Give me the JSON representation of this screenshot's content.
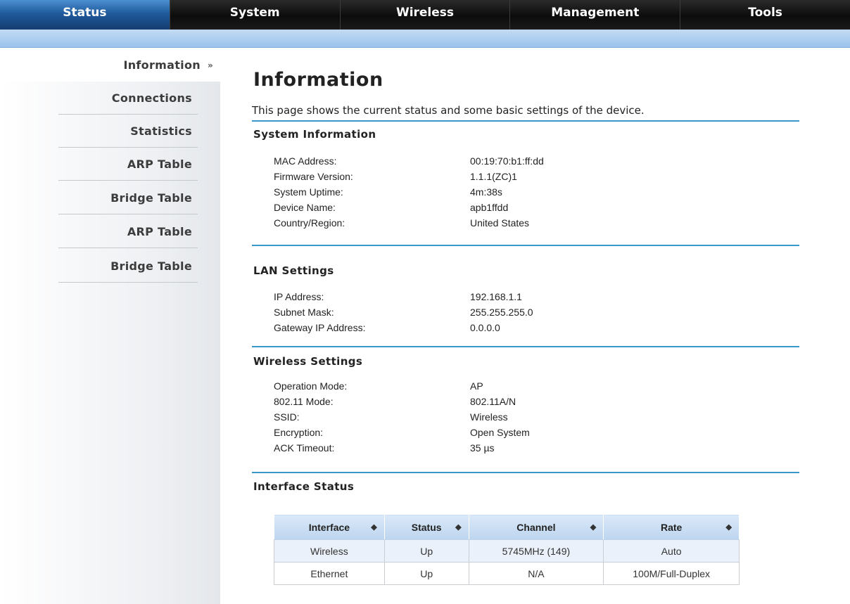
{
  "topnav": {
    "tabs": [
      {
        "label": "Status",
        "active": true
      },
      {
        "label": "System",
        "active": false
      },
      {
        "label": "Wireless",
        "active": false
      },
      {
        "label": "Management",
        "active": false
      },
      {
        "label": "Tools",
        "active": false
      }
    ]
  },
  "sidebar": {
    "items": [
      {
        "label": "Information",
        "active": true,
        "arrow": "»"
      },
      {
        "label": "Connections"
      },
      {
        "label": "Statistics"
      },
      {
        "label": "ARP Table"
      },
      {
        "label": "Bridge Table"
      },
      {
        "label": "ARP Table"
      },
      {
        "label": "Bridge Table"
      }
    ]
  },
  "page": {
    "title": "Information",
    "description": "This page shows the current status and some basic settings of the device."
  },
  "system_info": {
    "heading": "System Information",
    "rows": [
      {
        "label": "MAC Address:",
        "value": "00:19:70:b1:ff:dd"
      },
      {
        "label": "Firmware Version:",
        "value": "1.1.1(ZC)1"
      },
      {
        "label": "System Uptime:",
        "value": "4m:38s"
      },
      {
        "label": "Device Name:",
        "value": "apb1ffdd"
      },
      {
        "label": "Country/Region:",
        "value": "United States"
      }
    ]
  },
  "lan_settings": {
    "heading": "LAN Settings",
    "rows": [
      {
        "label": "IP Address:",
        "value": "192.168.1.1"
      },
      {
        "label": "Subnet Mask:",
        "value": "255.255.255.0"
      },
      {
        "label": "Gateway IP Address:",
        "value": "0.0.0.0"
      }
    ]
  },
  "wireless_settings": {
    "heading": "Wireless Settings",
    "rows": [
      {
        "label": "Operation Mode:",
        "value": "AP"
      },
      {
        "label": "802.11 Mode:",
        "value": "802.11A/N"
      },
      {
        "label": "SSID:",
        "value": "Wireless"
      },
      {
        "label": "Encryption:",
        "value": "Open System"
      },
      {
        "label": "ACK Timeout:",
        "value": "35 µs"
      }
    ]
  },
  "interface_status": {
    "heading": "Interface Status",
    "columns": [
      "Interface",
      "Status",
      "Channel",
      "Rate"
    ],
    "sort_icon": "sort-icon",
    "rows": [
      [
        "Wireless",
        "Up",
        "5745MHz (149)",
        "Auto"
      ],
      [
        "Ethernet",
        "Up",
        "N/A",
        "100M/Full-Duplex"
      ]
    ]
  },
  "colors": {
    "accent_blue": "#3b97c8",
    "active_tab": "#1f5a9c",
    "subbar": "#9ac3ec",
    "table_header": "#bcd5ef"
  }
}
